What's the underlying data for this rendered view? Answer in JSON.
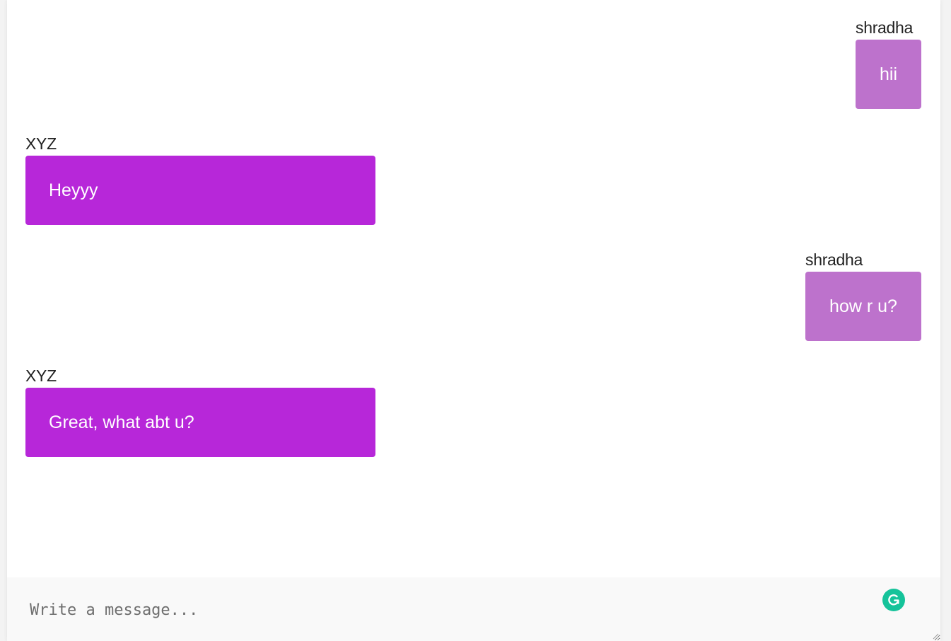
{
  "colors": {
    "outgoing_bubble": "#bd72cc",
    "incoming_bubble": "#b727d9",
    "grammarly_icon": "#15c39a"
  },
  "messages": [
    {
      "sender": "shradha",
      "text": "hii",
      "direction": "outgoing"
    },
    {
      "sender": "XYZ",
      "text": "Heyyy",
      "direction": "incoming"
    },
    {
      "sender": "shradha",
      "text": "how r u?",
      "direction": "outgoing"
    },
    {
      "sender": "XYZ",
      "text": "Great, what abt u?",
      "direction": "incoming"
    }
  ],
  "composer": {
    "placeholder": "Write a message...",
    "value": "",
    "icon": "grammarly-icon"
  }
}
